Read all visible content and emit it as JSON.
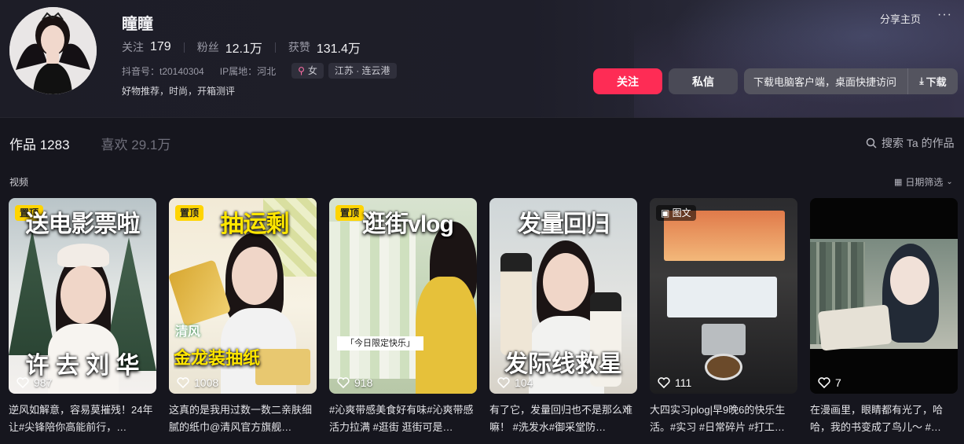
{
  "profile": {
    "name": "瞳瞳",
    "stats": [
      {
        "label": "关注",
        "value": "179"
      },
      {
        "label": "粉丝",
        "value": "12.1万"
      },
      {
        "label": "获赞",
        "value": "131.4万"
      }
    ],
    "douyin_id": "抖音号：t20140304",
    "ip_location": "IP属地：河北",
    "gender_tag": "女",
    "gender_icon": "female-icon",
    "region_tag": "江苏 · 连云港",
    "bio": "好物推荐，时尚，开箱测评"
  },
  "actions": {
    "share": "分享主页",
    "more": "···",
    "follow": "关注",
    "message": "私信",
    "download_prompt": "下载电脑客户端，桌面快捷访问",
    "download_button": "下载",
    "follow_color": "#fe2c55"
  },
  "tabs": {
    "works": "作品 1283",
    "likes": "喜欢 29.1万"
  },
  "search": {
    "label": "搜索 Ta 的作品"
  },
  "section": {
    "label": "视频",
    "filter": "日期筛选"
  },
  "videos": [
    {
      "pin": "置顶",
      "overlay_top": "送电影票啦",
      "overlay_bottom": "许 去 刘 华",
      "likes": "987",
      "caption": "逆风如解意，容易莫摧残！24年让#尖锋陪你高能前行，…"
    },
    {
      "pin": "置顶",
      "overlay_top": "抽运剩",
      "overlay_bottom": "金龙装抽纸",
      "overlay_brand": "清风",
      "likes": "1008",
      "caption": "这真的是我用过数一数二亲肤细腻的纸巾@清风官方旗舰…"
    },
    {
      "pin": "置顶",
      "overlay_top": "逛街vlog",
      "overlay_sticker": "「今日限定快乐」",
      "likes": "918",
      "caption": "#沁爽带感美食好有味#沁爽带感活力拉满 #逛街 逛街可是…"
    },
    {
      "overlay_top": "发量回归",
      "overlay_bottom": "发际线救星",
      "likes": "104",
      "caption": "有了它，发量回归也不是那么难嘛！ #洗发水#御采堂防…"
    },
    {
      "type_badge": "图文",
      "likes": "111",
      "caption": "大四实习plog|早9晚6的快乐生活。#实习 #日常碎片 #打工…"
    },
    {
      "likes": "7",
      "caption": "在漫画里，眼睛都有光了，哈哈，我的书变成了鸟儿～ #…"
    }
  ]
}
